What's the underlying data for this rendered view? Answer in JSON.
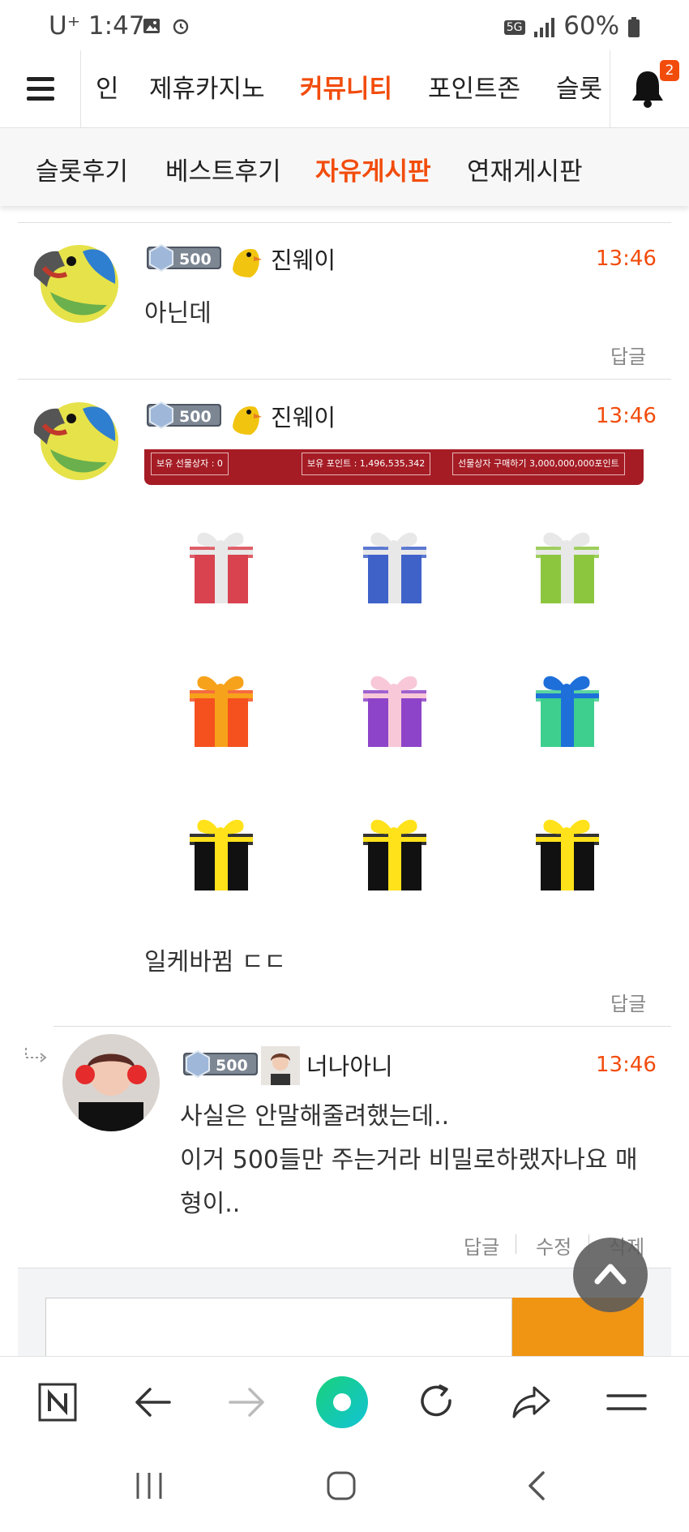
{
  "status_bar": {
    "carrier": "U⁺",
    "time": "1:47",
    "network": "5G",
    "battery": "60%"
  },
  "top_nav": {
    "items": [
      "인",
      "제휴카지노",
      "커뮤니티",
      "포인트존",
      "슬롯"
    ],
    "active": "커뮤니티",
    "notification_count": "2"
  },
  "sub_nav": {
    "items": [
      "슬롯후기",
      "베스트후기",
      "자유게시판",
      "연재게시판"
    ],
    "active": "자유게시판"
  },
  "comments": [
    {
      "level": "500",
      "nickname": "진웨이",
      "time": "13:46",
      "text": "아닌데",
      "reply_label": "답글"
    },
    {
      "level": "500",
      "nickname": "진웨이",
      "time": "13:46",
      "banner": {
        "owned_boxes": "보유 선물상자 : 0",
        "owned_points": "보유 포인트 : 1,496,535,342",
        "buy_box": "선물상자 구매하기 3,000,000,000포인트"
      },
      "gift_colors": [
        {
          "box": "#d8434f",
          "ribbon": "#e8e8e8"
        },
        {
          "box": "#3f62c9",
          "ribbon": "#e8e8e8"
        },
        {
          "box": "#8cc63f",
          "ribbon": "#e8e8e8"
        },
        {
          "box": "#f4511e",
          "ribbon": "#f7a21b"
        },
        {
          "box": "#8e44c8",
          "ribbon": "#f8c8d8"
        },
        {
          "box": "#3ecf8e",
          "ribbon": "#1e6fd9"
        },
        {
          "box": "#111111",
          "ribbon": "#ffe21a"
        },
        {
          "box": "#111111",
          "ribbon": "#ffe21a"
        },
        {
          "box": "#111111",
          "ribbon": "#ffe21a"
        }
      ],
      "text": "일케바뀜 ㄷㄷ",
      "reply_label": "답글"
    },
    {
      "is_reply": true,
      "level": "500",
      "nickname": "너나아니",
      "time": "13:46",
      "text_lines": [
        "사실은 안말해줄려했는데..",
        "이거 500들만 주는거라 비밀로하랬자나요 매",
        "형이.."
      ],
      "actions": [
        "답글",
        "수정",
        "삭제"
      ]
    }
  ],
  "colors": {
    "accent": "#f24c0c",
    "submit": "#f09414",
    "banner": "#a51c25"
  },
  "browser_toolbar": {
    "icons": [
      "naver-n-icon",
      "back-arrow-icon",
      "forward-arrow-icon",
      "green-dot-icon",
      "refresh-icon",
      "share-icon",
      "menu-icon"
    ]
  },
  "system_nav": {
    "icons": [
      "recent-apps-icon",
      "home-icon",
      "back-icon"
    ]
  }
}
